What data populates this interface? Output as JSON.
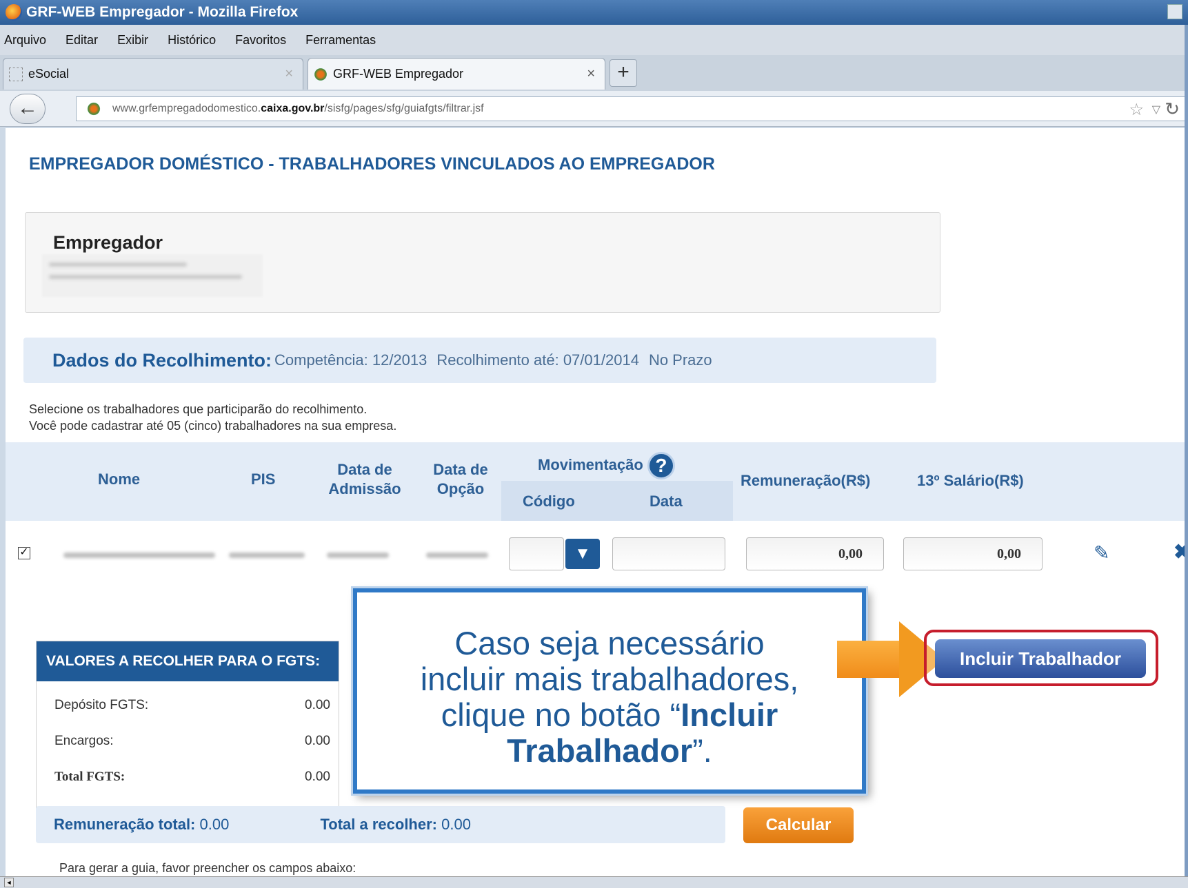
{
  "window": {
    "title": "GRF-WEB Empregador - Mozilla Firefox"
  },
  "menu": [
    "Arquivo",
    "Editar",
    "Exibir",
    "Histórico",
    "Favoritos",
    "Ferramentas"
  ],
  "tabs": [
    {
      "label": "eSocial",
      "close": "×"
    },
    {
      "label": "GRF-WEB Empregador",
      "close": "×"
    }
  ],
  "newtab": "+",
  "nav": {
    "url_prefix": "www.grfempregadodomestico.",
    "url_domain": "caixa.gov.br",
    "url_path": "/sisfg/pages/sfg/guiafgts/filtrar.jsf"
  },
  "page": {
    "title": "EMPREGADOR DOMÉSTICO - TRABALHADORES VINCULADOS AO EMPREGADOR",
    "employer_label": "Empregador",
    "dados_label": "Dados do Recolhimento:",
    "competencia": "Competência: 12/2013",
    "recolhimento": "Recolhimento até: 07/01/2014",
    "prazo": "No Prazo",
    "hint1": "Selecione os trabalhadores que participarão do recolhimento.",
    "hint2": "Você pode cadastrar até 05 (cinco) trabalhadores na sua empresa."
  },
  "table": {
    "col_nome": "Nome",
    "col_pis": "PIS",
    "col_admissao_1": "Data de",
    "col_admissao_2": "Admissão",
    "col_opcao_1": "Data de",
    "col_opcao_2": "Opção",
    "col_mov": "Movimentação",
    "col_codigo": "Código",
    "col_data": "Data",
    "col_remun": "Remuneração(R$)",
    "col_13": "13º Salário(R$)",
    "row": {
      "checked": "☑",
      "remuneracao": "0,00",
      "decimo": "0,00"
    }
  },
  "valores": {
    "header": "VALORES A RECOLHER PARA O FGTS:",
    "deposito_label": "Depósito FGTS:",
    "deposito_value": "0.00",
    "encargos_label": "Encargos:",
    "encargos_value": "0.00",
    "total_label": "Total FGTS:",
    "total_value": "0.00"
  },
  "totals": {
    "remun_label": "Remuneração total:",
    "remun_value": "0.00",
    "recolher_label": "Total a recolher:",
    "recolher_value": "0.00"
  },
  "buttons": {
    "calcular": "Calcular",
    "incluir": "Incluir Trabalhador"
  },
  "footer_text": "Para gerar a guia, favor preencher os campos abaixo:",
  "callout": {
    "line1": "Caso seja necessário",
    "line2": "incluir mais trabalhadores,",
    "line3_pre": "clique no botão “",
    "line3_bold": "Incluir",
    "line4_bold": "Trabalhador",
    "line4_post": "”."
  },
  "colors": {
    "brand_blue": "#1f5a97",
    "accent_orange": "#f29a20",
    "highlight_red": "#c61d2c"
  }
}
